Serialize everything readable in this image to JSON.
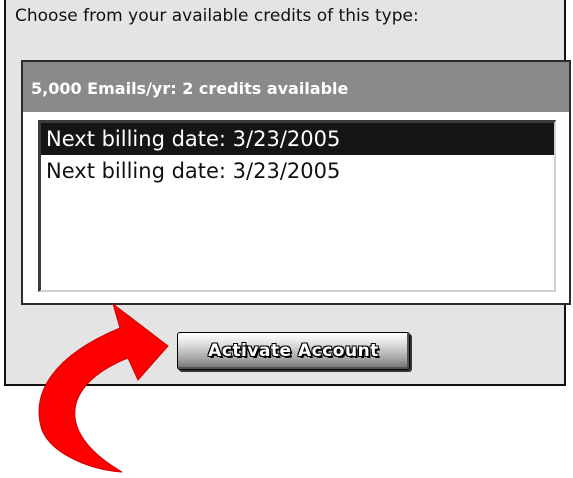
{
  "prompt": "Choose from your available credits of this type:",
  "credit_group": {
    "header": "5,000 Emails/yr: 2 credits available",
    "options": [
      {
        "label": "Next billing date: 3/23/2005",
        "selected": true
      },
      {
        "label": "Next billing date: 3/23/2005",
        "selected": false
      }
    ]
  },
  "activate_button": {
    "label": "Activate Account"
  },
  "annotation": {
    "icon": "curved-arrow-icon",
    "color": "#ff0000"
  }
}
